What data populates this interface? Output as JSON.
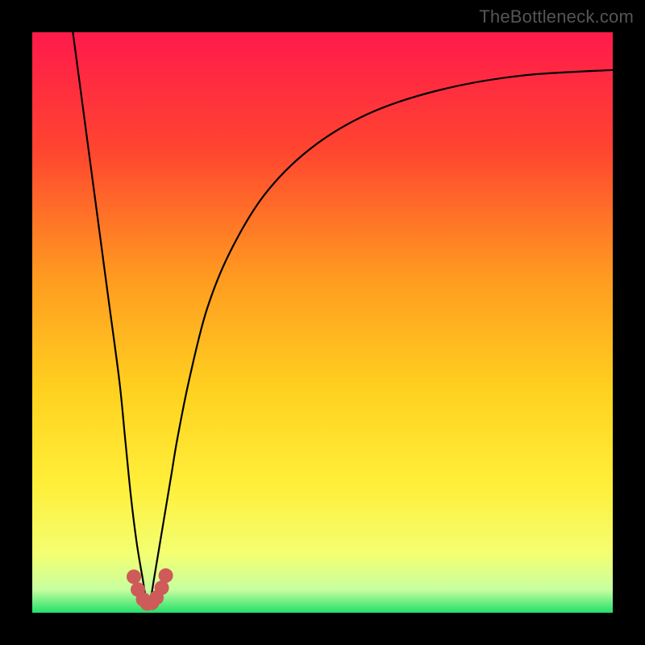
{
  "watermark": "TheBottleneck.com",
  "chart_data": {
    "type": "line",
    "title": "",
    "xlabel": "",
    "ylabel": "",
    "xlim": [
      0,
      100
    ],
    "ylim": [
      0,
      100
    ],
    "grid": false,
    "legend": false,
    "background_gradient": {
      "top_color": "#ff1a4b",
      "mid_colors": [
        "#ff6a2a",
        "#ffbf1f",
        "#ffe63a",
        "#f7ff6a"
      ],
      "bottom_color": "#22e06b"
    },
    "series": [
      {
        "name": "bottleneck-curve",
        "stroke": "#000000",
        "x": [
          7,
          9,
          11,
          13,
          15,
          16,
          17,
          18,
          19,
          19.7,
          20.3,
          21,
          22,
          23,
          24,
          25,
          27,
          30,
          34,
          40,
          48,
          58,
          70,
          84,
          100
        ],
        "y": [
          100,
          85,
          70,
          55,
          40,
          30,
          20,
          12,
          6,
          2,
          2,
          6,
          12,
          18,
          24,
          30,
          40,
          52,
          62,
          72,
          80,
          86,
          90,
          92.5,
          93.5
        ]
      }
    ],
    "markers": {
      "name": "valley-points",
      "color": "#cf5a5a",
      "radius": 9,
      "x": [
        17.5,
        18.2,
        19.1,
        19.8,
        20.6,
        21.4,
        22.3,
        23.0
      ],
      "y": [
        6.2,
        4.0,
        2.3,
        1.6,
        1.7,
        2.6,
        4.3,
        6.4
      ]
    }
  }
}
